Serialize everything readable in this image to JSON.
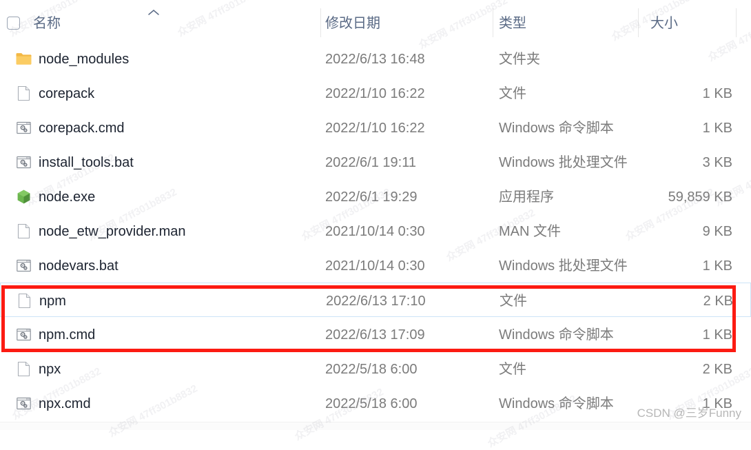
{
  "window": {
    "app": "Windows File Explorer",
    "view": "details-list"
  },
  "header": {
    "select_all_checkbox": "unchecked",
    "sort_indicator": "ascending",
    "columns": [
      {
        "key": "name",
        "label": "名称"
      },
      {
        "key": "date",
        "label": "修改日期"
      },
      {
        "key": "type",
        "label": "类型"
      },
      {
        "key": "size",
        "label": "大小"
      }
    ]
  },
  "files": [
    {
      "name": "node_modules",
      "date": "2022/6/13 16:48",
      "type": "文件夹",
      "size": "",
      "icon": "folder-icon",
      "selected": false,
      "highlighted": false
    },
    {
      "name": "corepack",
      "date": "2022/1/10 16:22",
      "type": "文件",
      "size": "1 KB",
      "icon": "generic-file-icon",
      "selected": false,
      "highlighted": false
    },
    {
      "name": "corepack.cmd",
      "date": "2022/1/10 16:22",
      "type": "Windows 命令脚本",
      "size": "1 KB",
      "icon": "script-file-icon",
      "selected": false,
      "highlighted": false
    },
    {
      "name": "install_tools.bat",
      "date": "2022/6/1 19:11",
      "type": "Windows 批处理文件",
      "size": "3 KB",
      "icon": "script-file-icon",
      "selected": false,
      "highlighted": false
    },
    {
      "name": "node.exe",
      "date": "2022/6/1 19:29",
      "type": "应用程序",
      "size": "59,859 KB",
      "icon": "nodejs-hexagon-icon",
      "selected": false,
      "highlighted": false
    },
    {
      "name": "node_etw_provider.man",
      "date": "2021/10/14 0:30",
      "type": "MAN 文件",
      "size": "9 KB",
      "icon": "generic-file-icon",
      "selected": false,
      "highlighted": false
    },
    {
      "name": "nodevars.bat",
      "date": "2021/10/14 0:30",
      "type": "Windows 批处理文件",
      "size": "1 KB",
      "icon": "script-file-icon",
      "selected": false,
      "highlighted": false
    },
    {
      "name": "npm",
      "date": "2022/6/13 17:10",
      "type": "文件",
      "size": "2 KB",
      "icon": "generic-file-icon",
      "selected": true,
      "highlighted": true
    },
    {
      "name": "npm.cmd",
      "date": "2022/6/13 17:09",
      "type": "Windows 命令脚本",
      "size": "1 KB",
      "icon": "script-file-icon",
      "selected": false,
      "highlighted": true
    },
    {
      "name": "npx",
      "date": "2022/5/18 6:00",
      "type": "文件",
      "size": "2 KB",
      "icon": "generic-file-icon",
      "selected": false,
      "highlighted": false
    },
    {
      "name": "npx.cmd",
      "date": "2022/5/18 6:00",
      "type": "Windows 命令脚本",
      "size": "1 KB",
      "icon": "script-file-icon",
      "selected": false,
      "highlighted": false
    }
  ],
  "annotation": {
    "shape": "rectangle",
    "color": "#fc1b12",
    "targets": [
      "npm",
      "npm.cmd"
    ]
  },
  "watermark": {
    "csdn": "CSDN @三岁Funny",
    "tile": "众安网 47ff301b8832"
  },
  "colors": {
    "background": "#ffffff",
    "header_text": "#5a6a85",
    "file_name_text": "#1c2330",
    "meta_text": "#7b7b7b",
    "column_separator": "#e6e6e6",
    "folder_icon": "#f7c14b",
    "node_icon": "#5fa04e",
    "annotation_red": "#fc1b12",
    "selection_border": "#cde4f7"
  }
}
